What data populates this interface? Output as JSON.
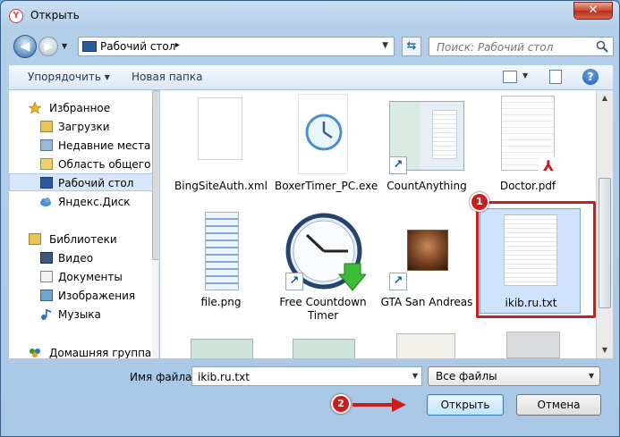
{
  "window": {
    "title": "Открыть",
    "close_glyph": "✕"
  },
  "nav": {
    "address_crumb": "Рабочий стол",
    "crumb_arrow": "▸",
    "search_placeholder": "Поиск: Рабочий стол"
  },
  "toolbar": {
    "organize_label": "Упорядочить ▾",
    "new_folder_label": "Новая папка",
    "help_label": "?"
  },
  "sidebar": {
    "items": [
      {
        "label": "Избранное",
        "icon": "star-icon"
      },
      {
        "label": "Загрузки",
        "icon": "downloads-icon"
      },
      {
        "label": "Недавние места",
        "icon": "recent-places-icon"
      },
      {
        "label": "Область общего д",
        "icon": "folder-icon"
      },
      {
        "label": "Рабочий стол",
        "icon": "desktop-icon",
        "selected": true
      },
      {
        "label": "Яндекс.Диск",
        "icon": "cloud-icon"
      },
      {
        "label": "Библиотеки",
        "icon": "libraries-icon"
      },
      {
        "label": "Видео",
        "icon": "video-icon"
      },
      {
        "label": "Документы",
        "icon": "documents-icon"
      },
      {
        "label": "Изображения",
        "icon": "images-icon"
      },
      {
        "label": "Музыка",
        "icon": "music-icon"
      },
      {
        "label": "Домашняя группа",
        "icon": "homegroup-icon"
      }
    ]
  },
  "files": [
    {
      "name": "BingSiteAuth.xml",
      "icon": "generic-file-icon"
    },
    {
      "name": "BoxerTimer_PC.exe",
      "icon": "clock-app-icon"
    },
    {
      "name": "CountAnything",
      "icon": "app-shortcut-icon"
    },
    {
      "name": "Doctor.pdf",
      "icon": "pdf-icon"
    },
    {
      "name": "file.png",
      "icon": "image-file-icon"
    },
    {
      "name": "Free Countdown Timer",
      "icon": "countdown-timer-icon"
    },
    {
      "name": "GTA San Andreas",
      "icon": "game-shortcut-icon"
    },
    {
      "name": "ikib.ru.txt",
      "icon": "text-file-icon",
      "selected": true
    }
  ],
  "bottom": {
    "filename_label": "Имя файла:",
    "filename_value": "ikib.ru.txt",
    "filter_value": "Все файлы",
    "open_label": "Открыть",
    "cancel_label": "Отмена"
  },
  "annotations": {
    "badge1": "1",
    "badge2": "2"
  },
  "colors": {
    "annotation_red": "#c81e1e",
    "selection_blue": "#cfe3fc",
    "window_frame": "#a9c8e6"
  }
}
